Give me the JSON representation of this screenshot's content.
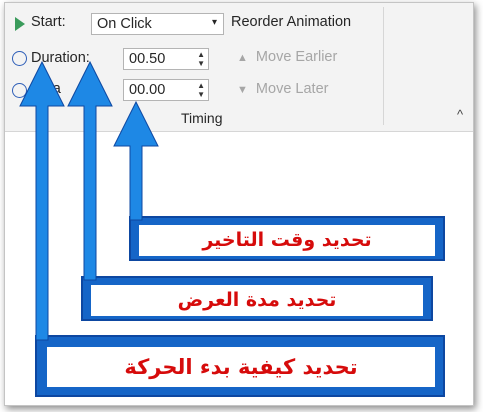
{
  "timing": {
    "start_label": "Start:",
    "start_value": "On Click",
    "duration_label": "Duration:",
    "duration_value": "00.50",
    "delay_label": "Dela",
    "delay_value": "00.00",
    "group_label": "Timing"
  },
  "reorder": {
    "title": "Reorder Animation",
    "move_earlier": "Move Earlier",
    "move_later": "Move Later"
  },
  "annotations": {
    "delay_note": "تحديد وقت التاخير",
    "duration_note": "تحديد مدة العرض",
    "start_note": "تحديد كيفية بدء الحركة"
  },
  "colors": {
    "arrow": "#1e88e5",
    "label_text": "#d60b0b",
    "label_frame": "#1565c7"
  }
}
